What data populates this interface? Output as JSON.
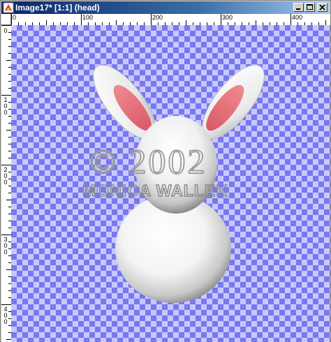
{
  "window": {
    "title": "Image17* [1:1] (head)",
    "controls": [
      "minimize",
      "maximize",
      "close"
    ]
  },
  "ruler": {
    "horizontal_labels": [
      "0",
      "100",
      "200",
      "300",
      "400"
    ],
    "vertical_labels": [
      "0",
      "100",
      "200",
      "300",
      "400"
    ]
  },
  "canvas": {
    "background": "transparency-checkerboard",
    "checker_colors": [
      "#7878f0",
      "#c8c8ff"
    ],
    "subject": "bunny",
    "watermark_line1": "© 2002",
    "watermark_line2": "MONICA WALLEK"
  }
}
